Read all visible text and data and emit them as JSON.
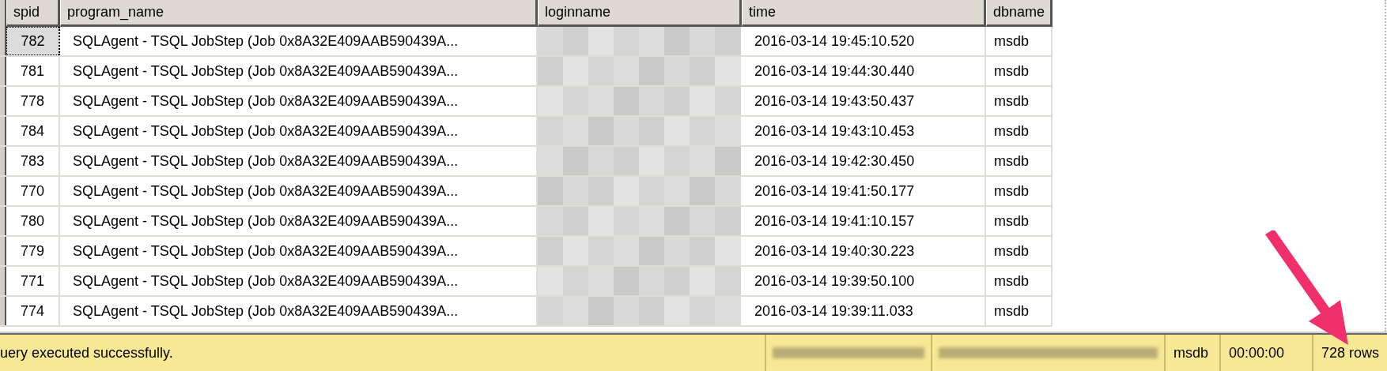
{
  "table": {
    "columns": [
      "spid",
      "program_name",
      "loginname",
      "time",
      "dbname"
    ],
    "rows": [
      {
        "spid": "782",
        "program_name": "SQLAgent - TSQL JobStep (Job 0x8A32E409AAB590439A...",
        "time": "2016-03-14 19:45:10.520",
        "dbname": "msdb",
        "selected": true
      },
      {
        "spid": "781",
        "program_name": "SQLAgent - TSQL JobStep (Job 0x8A32E409AAB590439A...",
        "time": "2016-03-14 19:44:30.440",
        "dbname": "msdb",
        "selected": false
      },
      {
        "spid": "778",
        "program_name": "SQLAgent - TSQL JobStep (Job 0x8A32E409AAB590439A...",
        "time": "2016-03-14 19:43:50.437",
        "dbname": "msdb",
        "selected": false
      },
      {
        "spid": "784",
        "program_name": "SQLAgent - TSQL JobStep (Job 0x8A32E409AAB590439A...",
        "time": "2016-03-14 19:43:10.453",
        "dbname": "msdb",
        "selected": false
      },
      {
        "spid": "783",
        "program_name": "SQLAgent - TSQL JobStep (Job 0x8A32E409AAB590439A...",
        "time": "2016-03-14 19:42:30.450",
        "dbname": "msdb",
        "selected": false
      },
      {
        "spid": "770",
        "program_name": "SQLAgent - TSQL JobStep (Job 0x8A32E409AAB590439A...",
        "time": "2016-03-14 19:41:50.177",
        "dbname": "msdb",
        "selected": false
      },
      {
        "spid": "780",
        "program_name": "SQLAgent - TSQL JobStep (Job 0x8A32E409AAB590439A...",
        "time": "2016-03-14 19:41:10.157",
        "dbname": "msdb",
        "selected": false
      },
      {
        "spid": "779",
        "program_name": "SQLAgent - TSQL JobStep (Job 0x8A32E409AAB590439A...",
        "time": "2016-03-14 19:40:30.223",
        "dbname": "msdb",
        "selected": false
      },
      {
        "spid": "771",
        "program_name": "SQLAgent - TSQL JobStep (Job 0x8A32E409AAB590439A...",
        "time": "2016-03-14 19:39:50.100",
        "dbname": "msdb",
        "selected": false
      },
      {
        "spid": "774",
        "program_name": "SQLAgent - TSQL JobStep (Job 0x8A32E409AAB590439A...",
        "time": "2016-03-14 19:39:11.033",
        "dbname": "msdb",
        "selected": false
      }
    ]
  },
  "status_bar": {
    "message": "uery executed successfully.",
    "database": "msdb",
    "elapsed": "00:00:00",
    "row_count": "728 rows"
  }
}
